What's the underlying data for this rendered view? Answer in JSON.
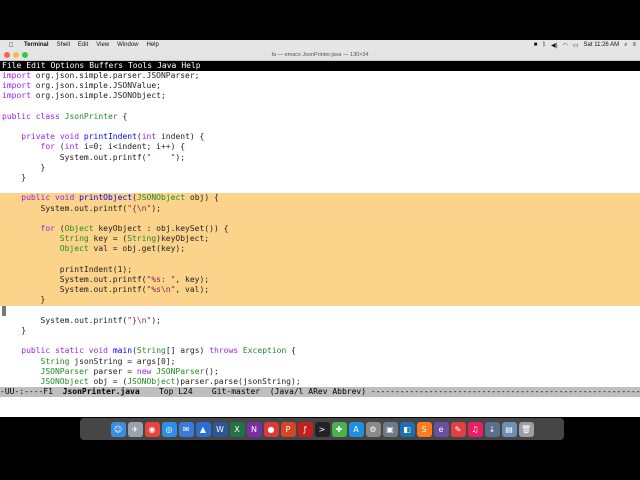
{
  "system_menu": {
    "apple": "",
    "items": [
      {
        "label": "Terminal",
        "bold": true
      },
      {
        "label": "Shell"
      },
      {
        "label": "Edit"
      },
      {
        "label": "View"
      },
      {
        "label": "Window"
      },
      {
        "label": "Help"
      }
    ],
    "status": {
      "time": "Sat 11:26 AM"
    }
  },
  "window": {
    "title": "fa — emacs JsonPrinter.java — 130×34"
  },
  "emacs_menu": [
    "File",
    "Edit",
    "Options",
    "Buffers",
    "Tools",
    "Java",
    "Help"
  ],
  "code_lines": [
    {
      "text": "import org.json.simple.parser.JSONParser;"
    },
    {
      "text": "import org.json.simple.JSONValue;"
    },
    {
      "text": "import org.json.simple.JSONObject;"
    },
    {
      "text": ""
    },
    {
      "text": "public class JsonPrinter {"
    },
    {
      "text": ""
    },
    {
      "text": "    private void printIndent(int indent) {"
    },
    {
      "text": "        for (int i=0; i<indent; i++) {"
    },
    {
      "text": "            System.out.printf(\"    \");"
    },
    {
      "text": "        }"
    },
    {
      "text": "    }"
    },
    {
      "text": ""
    },
    {
      "text": "    public void printObject(JSONObject obj) {",
      "hl": true
    },
    {
      "text": "        System.out.printf(\"{\\n\");",
      "hl": true
    },
    {
      "text": "",
      "hl": true
    },
    {
      "text": "        for (Object keyObject : obj.keySet()) {",
      "hl": true
    },
    {
      "text": "            String key = (String)keyObject;",
      "hl": true
    },
    {
      "text": "            Object val = obj.get(key);",
      "hl": true
    },
    {
      "text": "",
      "hl": true
    },
    {
      "text": "            printIndent(1);",
      "hl": true
    },
    {
      "text": "            System.out.printf(\"%s: \", key);",
      "hl": true
    },
    {
      "text": "            System.out.printf(\"%s\\n\", val);",
      "hl": true
    },
    {
      "text": "        }",
      "hl": true
    },
    {
      "text": "",
      "cursor": true
    },
    {
      "text": "        System.out.printf(\"}\\n\");"
    },
    {
      "text": "    }"
    },
    {
      "text": ""
    },
    {
      "text": "    public static void main(String[] args) throws Exception {"
    },
    {
      "text": "        String jsonString = args[0];"
    },
    {
      "text": "        JSONParser parser = new JSONParser();"
    },
    {
      "text": "        JSONObject obj = (JSONObject)parser.parse(jsonString);"
    }
  ],
  "modeline": {
    "prefix": "-UU-:----F1  ",
    "buffer": "JsonPrinter.java",
    "rest": "    Top L24    Git-master  (Java/l ARev Abbrev) -----------------------------------------------------------------------"
  },
  "dock_icons": [
    {
      "name": "finder-icon",
      "color": "#3b8fe0",
      "glyph": "☺"
    },
    {
      "name": "launchpad-icon",
      "color": "#9aa3ad",
      "glyph": "✈"
    },
    {
      "name": "chrome-icon",
      "color": "#e8453c",
      "glyph": "◉"
    },
    {
      "name": "safari-icon",
      "color": "#2f8fe6",
      "glyph": "◎"
    },
    {
      "name": "mail-icon",
      "color": "#3a7bd5",
      "glyph": "✉"
    },
    {
      "name": "keynote-icon",
      "color": "#2b6fd6",
      "glyph": "▲"
    },
    {
      "name": "word-icon",
      "color": "#2b579a",
      "glyph": "W"
    },
    {
      "name": "excel-icon",
      "color": "#217346",
      "glyph": "X"
    },
    {
      "name": "onenote-icon",
      "color": "#7b2fa5",
      "glyph": "N"
    },
    {
      "name": "record-icon",
      "color": "#d93a3a",
      "glyph": "●"
    },
    {
      "name": "powerpoint-icon",
      "color": "#d24726",
      "glyph": "P"
    },
    {
      "name": "flash-icon",
      "color": "#c41e1e",
      "glyph": "ƒ"
    },
    {
      "name": "terminal-icon",
      "color": "#222222",
      "glyph": ">"
    },
    {
      "name": "maps-icon",
      "color": "#4caf50",
      "glyph": "✚"
    },
    {
      "name": "app-store-icon",
      "color": "#1e8fe1",
      "glyph": "A"
    },
    {
      "name": "system-preferences-icon",
      "color": "#8a8a8a",
      "glyph": "⚙"
    },
    {
      "name": "vmware-icon",
      "color": "#6d7c8a",
      "glyph": "▣"
    },
    {
      "name": "virtualbox-icon",
      "color": "#1b6fb5",
      "glyph": "◧"
    },
    {
      "name": "sublime-icon",
      "color": "#ff7b1c",
      "glyph": "S"
    },
    {
      "name": "emacs-icon",
      "color": "#6b4fa3",
      "glyph": "e"
    },
    {
      "name": "pencil-icon",
      "color": "#e04040",
      "glyph": "✎"
    },
    {
      "name": "itunes-icon",
      "color": "#e91e63",
      "glyph": "♫"
    },
    {
      "name": "downloads-icon",
      "color": "#5a6f8a",
      "glyph": "↓"
    },
    {
      "name": "documents-icon",
      "color": "#6c8fb3",
      "glyph": "▤"
    },
    {
      "name": "trash-icon",
      "color": "#9aa0a6",
      "glyph": "🗑"
    }
  ]
}
